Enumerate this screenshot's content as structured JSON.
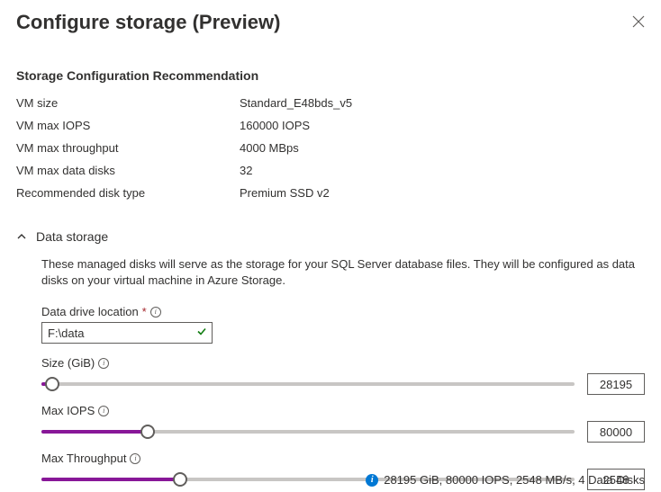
{
  "header": {
    "title": "Configure storage (Preview)"
  },
  "recommendation": {
    "heading": "Storage Configuration Recommendation",
    "rows": [
      {
        "label": "VM size",
        "value": "Standard_E48bds_v5"
      },
      {
        "label": "VM max IOPS",
        "value": "160000 IOPS"
      },
      {
        "label": "VM max throughput",
        "value": "4000 MBps"
      },
      {
        "label": "VM max data disks",
        "value": "32"
      },
      {
        "label": "Recommended disk type",
        "value": "Premium SSD v2"
      }
    ]
  },
  "dataStorage": {
    "section_title": "Data storage",
    "description": "These managed disks will serve as the storage for your SQL Server database files. They will be configured as data disks on your virtual machine in Azure Storage.",
    "drive_label": "Data drive location",
    "drive_value": "F:\\data",
    "sliders": [
      {
        "label": "Size (GiB)",
        "value": "28195",
        "fill_pct": 2
      },
      {
        "label": "Max IOPS",
        "value": "80000",
        "fill_pct": 20
      },
      {
        "label": "Max Throughput",
        "value": "2548",
        "fill_pct": 26
      }
    ],
    "summary": "28195 GiB, 80000 IOPS, 2548 MB/s, 4 Data Disks"
  }
}
